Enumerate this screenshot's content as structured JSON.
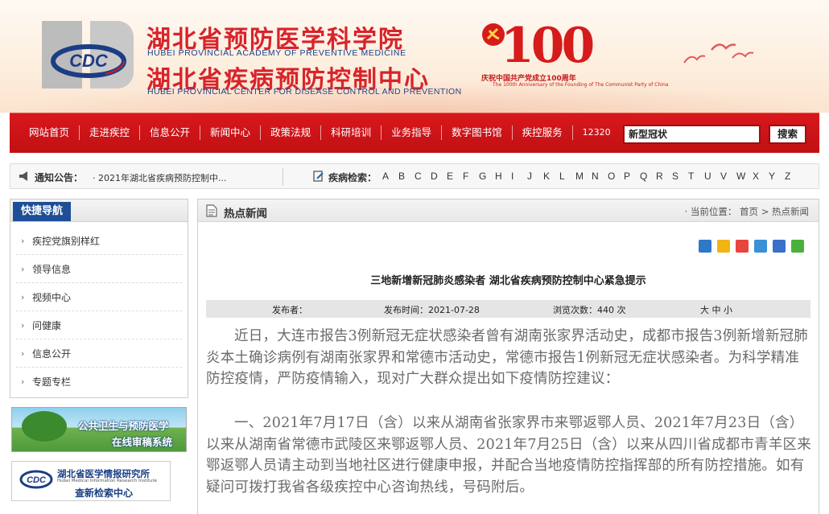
{
  "header": {
    "institute_cn": "湖北省预防医学科学院",
    "institute_en": "HUBEI PROVINCIAL ACADEMY OF PREVENTIVE MEDICINE",
    "center_cn": "湖北省疾病预防控制中心",
    "center_en": "HUBEI PROVINCIAL CENTER FOR DISEASE CONTROL AND PREVENTION",
    "logo_text": "CDC",
    "anniversary": {
      "number": "100",
      "caption": "庆祝中国共产党成立100周年",
      "sub_en": "The 100th Anniversary of the Founding of The Communist Party of China"
    }
  },
  "nav": {
    "items": [
      "网站首页",
      "走进疾控",
      "信息公开",
      "新闻中心",
      "政策法规",
      "科研培训",
      "业务指导",
      "数字图书馆",
      "疾控服务",
      "12320"
    ],
    "search_value": "新型冠状",
    "search_button": "搜索"
  },
  "notice": {
    "label": "通知公告：",
    "text": "· 2021年湖北省疾病预防控制中...",
    "disease_label": "疾病检索：",
    "letters": [
      "A",
      "B",
      "C",
      "D",
      "E",
      "F",
      "G",
      "H",
      "I",
      "J",
      "K",
      "L",
      "M",
      "N",
      "O",
      "P",
      "Q",
      "R",
      "S",
      "T",
      "U",
      "V",
      "W",
      "X",
      "Y",
      "Z"
    ]
  },
  "sidebar": {
    "title": "快捷导航",
    "items": [
      "疾控党旗别样红",
      "领导信息",
      "视频中心",
      "问健康",
      "信息公开",
      "专题专栏"
    ]
  },
  "promos": {
    "banner1_line1": "公共卫生与预防医学",
    "banner1_line2": "在线审稿系统",
    "banner2_name": "湖北省医学情报研究所",
    "banner2_en": "Hubei Medical Information Research Institute",
    "banner2_service": "查新检索中心"
  },
  "main": {
    "section_title": "热点新闻",
    "breadcrumb": "· 当前位置： 首页 > 热点新闻",
    "article": {
      "title": "三地新增新冠肺炎感染者  湖北省疾病预防控制中心紧急提示",
      "publisher_label": "发布者：",
      "time_label": "发布时间：2021-07-28",
      "views_label": "浏览次数：440 次",
      "font_size_label": "大 中 小",
      "paragraph1": "近日，大连市报告3例新冠无症状感染者曾有湖南张家界活动史，成都市报告3例新增新冠肺炎本土确诊病例有湖南张家界和常德市活动史，常德市报告1例新冠无症状感染者。为科学精准防控疫情，严防疫情输入，现对广大群众提出如下疫情防控建议：",
      "paragraph2": "一、2021年7月17日（含）以来从湖南省张家界市来鄂返鄂人员、2021年7月23日（含）以来从湖南省常德市武陵区来鄂返鄂人员、2021年7月25日（含）以来从四川省成都市青羊区来鄂返鄂人员请主动到当地社区进行健康申报，并配合当地疫情防控指挥部的所有防控措施。如有疑问可拨打我省各级疾控中心咨询热线，号码附后。"
    }
  },
  "colors": {
    "nav_red": "#c8151a",
    "title_red": "#d8232a",
    "sidebar_blue": "#1e4f96",
    "body_text": "#6a6a6a"
  }
}
